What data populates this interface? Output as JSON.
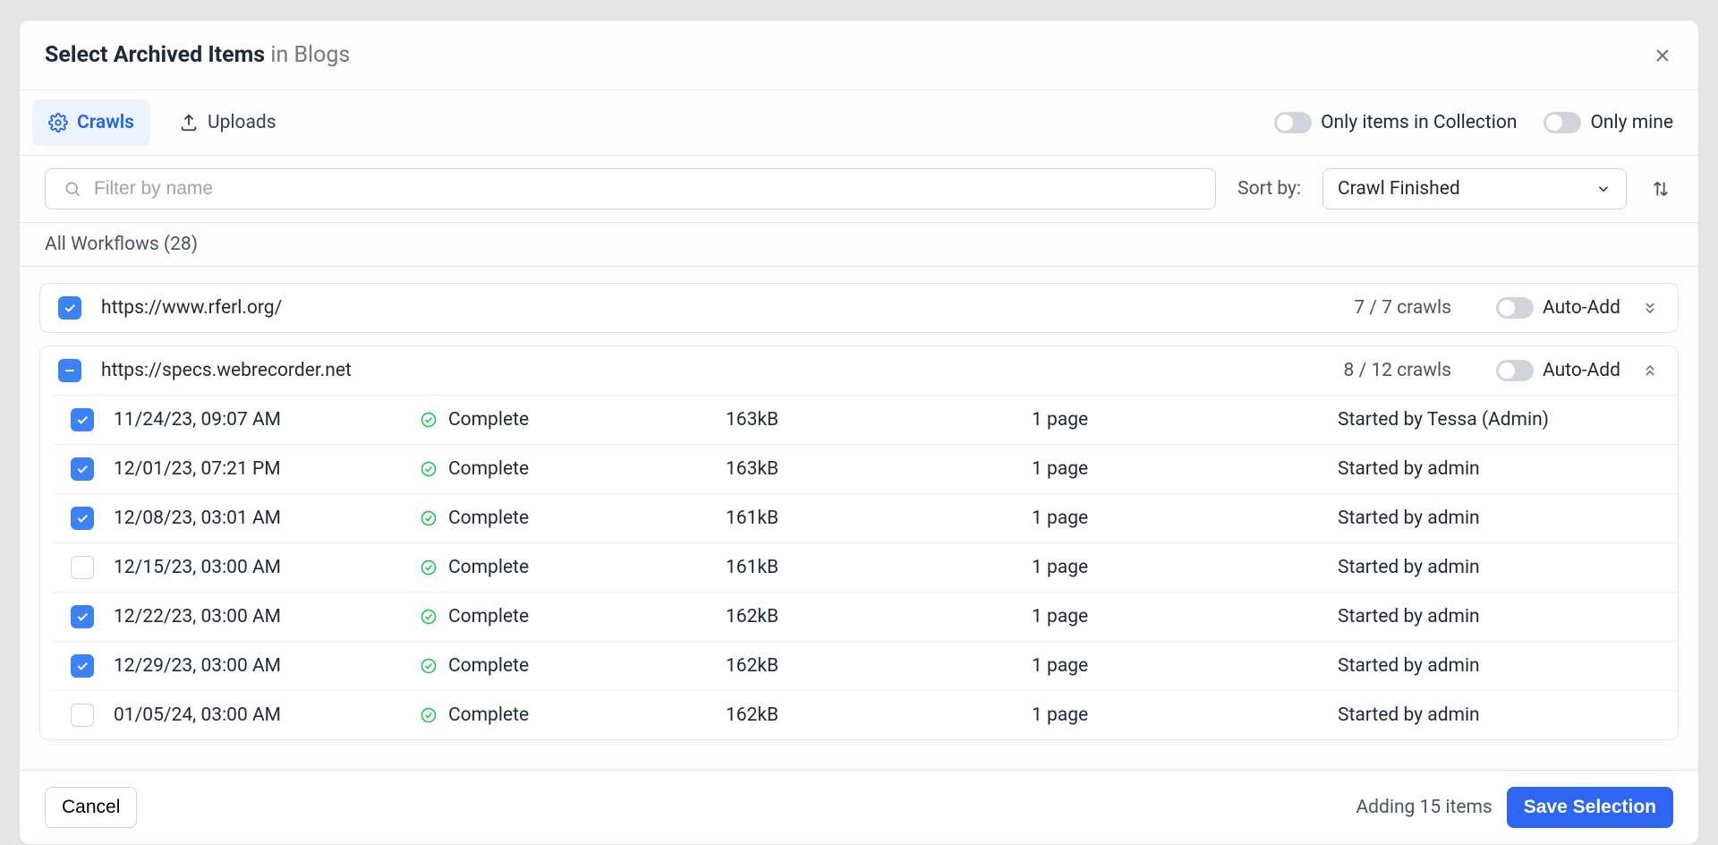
{
  "dialog": {
    "title": "Select Archived Items",
    "context": "in Blogs"
  },
  "tabs": {
    "crawls": "Crawls",
    "uploads": "Uploads"
  },
  "filters": {
    "only_collection": "Only items in Collection",
    "only_mine": "Only mine",
    "search_placeholder": "Filter by name",
    "sort_label": "Sort by:",
    "sort_value": "Crawl Finished"
  },
  "subsection": "All Workflows (28)",
  "groups": [
    {
      "check_state": "checked",
      "title": "https://www.rferl.org/",
      "count": "7 / 7 crawls",
      "autoadd": "Auto-Add",
      "expanded": false
    },
    {
      "check_state": "indet",
      "title": "https://specs.webrecorder.net",
      "count": "8 / 12 crawls",
      "autoadd": "Auto-Add",
      "expanded": true,
      "rows": [
        {
          "checked": true,
          "date": "11/24/23, 09:07 AM",
          "status": "Complete",
          "size": "163kB",
          "pages": "1 page",
          "starter": "Started by Tessa (Admin)"
        },
        {
          "checked": true,
          "date": "12/01/23, 07:21 PM",
          "status": "Complete",
          "size": "163kB",
          "pages": "1 page",
          "starter": "Started by admin"
        },
        {
          "checked": true,
          "date": "12/08/23, 03:01 AM",
          "status": "Complete",
          "size": "161kB",
          "pages": "1 page",
          "starter": "Started by admin"
        },
        {
          "checked": false,
          "date": "12/15/23, 03:00 AM",
          "status": "Complete",
          "size": "161kB",
          "pages": "1 page",
          "starter": "Started by admin"
        },
        {
          "checked": true,
          "date": "12/22/23, 03:00 AM",
          "status": "Complete",
          "size": "162kB",
          "pages": "1 page",
          "starter": "Started by admin"
        },
        {
          "checked": true,
          "date": "12/29/23, 03:00 AM",
          "status": "Complete",
          "size": "162kB",
          "pages": "1 page",
          "starter": "Started by admin"
        },
        {
          "checked": false,
          "date": "01/05/24, 03:00 AM",
          "status": "Complete",
          "size": "162kB",
          "pages": "1 page",
          "starter": "Started by admin"
        }
      ]
    }
  ],
  "footer": {
    "cancel": "Cancel",
    "status": "Adding 15 items",
    "save": "Save Selection"
  }
}
